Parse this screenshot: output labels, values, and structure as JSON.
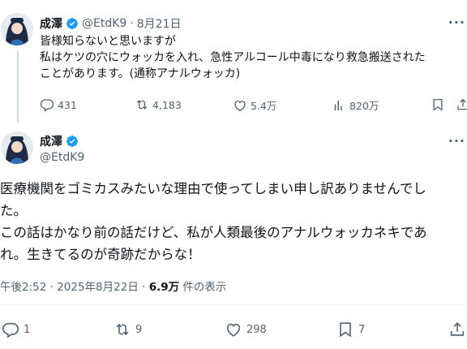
{
  "tweet1": {
    "display_name": "成澤",
    "handle": "@EtdK9",
    "separator": "·",
    "date": "8月21日",
    "lines": [
      "皆様知らないと思いますが",
      "私はケツの穴にウォッカを入れ、急性アルコール中毒になり救急搬送された",
      "ことがあります。(通称アナルウォッカ)"
    ],
    "actions": {
      "replies": "431",
      "reposts": "4,183",
      "likes": "5.4万",
      "views": "820万"
    }
  },
  "tweet2": {
    "display_name": "成澤",
    "handle": "@EtdK9",
    "lines": [
      "医療機関をゴミカスみたいな理由で使ってしまい申し訳ありませんでし",
      "た。",
      "この話はかなり前の話だけど、私が人類最後のアナルウォッカネキであ",
      "れ。生きてるのが奇跡だからな！"
    ],
    "timestamp": "午後2:52 · 2025年8月22日 ·",
    "view_count": "6.9万",
    "view_label": "件の表示",
    "actions": {
      "replies": "1",
      "reposts": "9",
      "likes": "298",
      "bookmarks": "7"
    }
  },
  "more_glyph": "···",
  "colors": {
    "verified": "#1d9bf0",
    "muted": "#536471",
    "text": "#0f1419"
  },
  "icons": [
    "reply-icon",
    "repost-icon",
    "like-icon",
    "views-icon",
    "bookmark-icon",
    "share-icon",
    "verified-badge-icon"
  ]
}
